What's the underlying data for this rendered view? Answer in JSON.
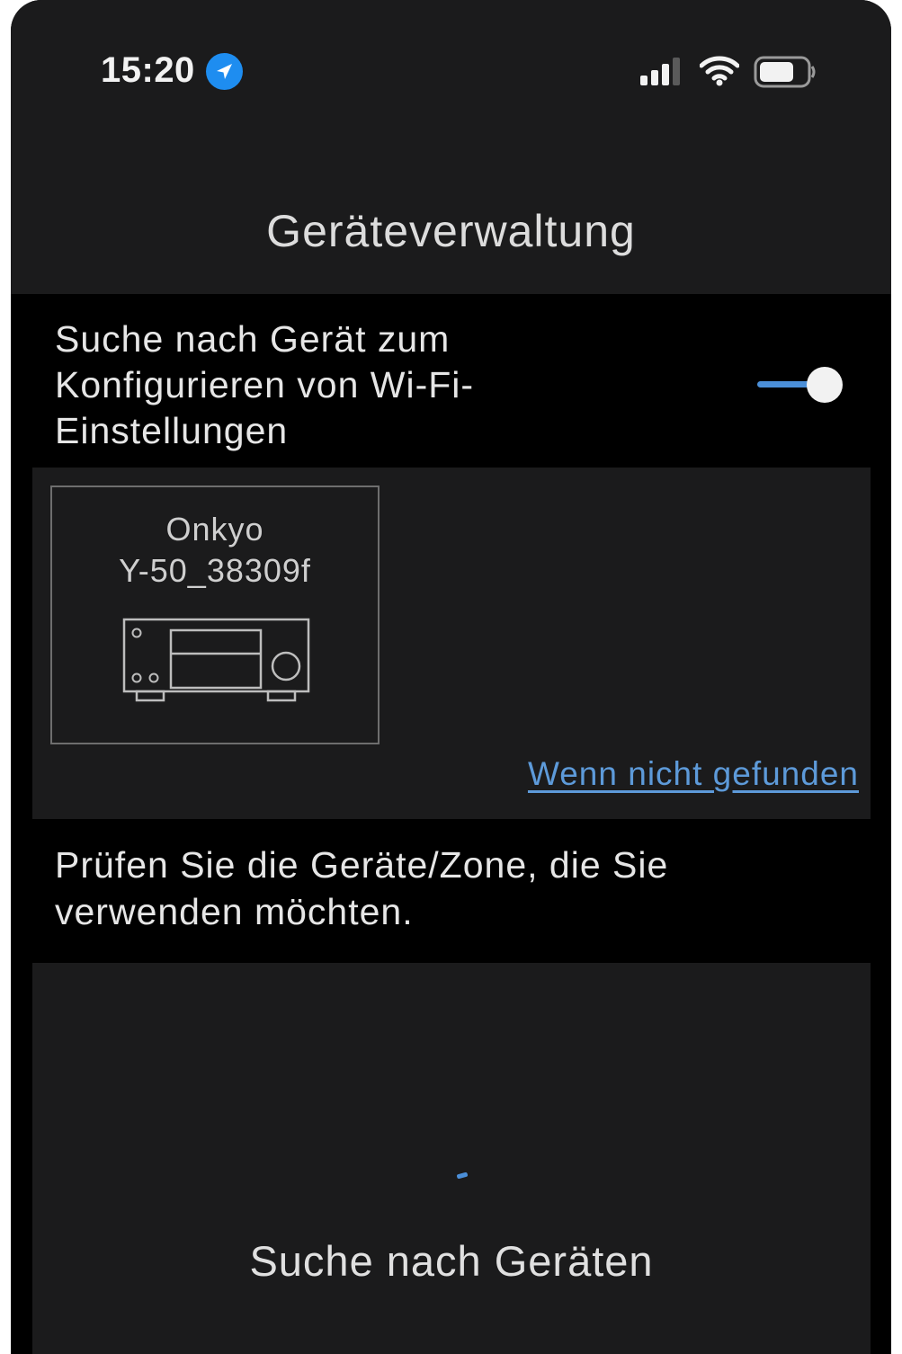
{
  "status_bar": {
    "time": "15:20",
    "icons": [
      "location-arrow-icon",
      "cellular-signal-icon",
      "wifi-icon",
      "battery-icon"
    ]
  },
  "header": {
    "title": "Geräteverwaltung"
  },
  "wifi_setup": {
    "label": "Suche nach Gerät zum Konfigurieren von Wi-Fi-Einstellungen",
    "toggle_on": true
  },
  "device_list": {
    "devices": [
      {
        "brand": "Onkyo",
        "model": "Y-50_38309f",
        "icon": "av-receiver-icon"
      }
    ],
    "not_found_link": "Wenn nicht gefunden"
  },
  "instruction": "Prüfen Sie die Geräte/Zone, die Sie verwenden möchten.",
  "search": {
    "label": "Suche nach Geräten"
  },
  "colors": {
    "accent": "#4b8fd8",
    "link": "#5d9ad9",
    "panel": "#1b1b1c",
    "background": "#000000",
    "location_badge": "#1e8df0"
  }
}
